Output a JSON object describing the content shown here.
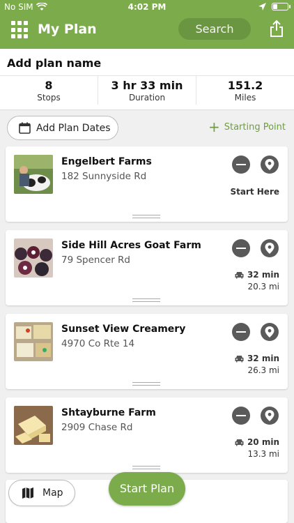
{
  "status_bar": {
    "carrier": "No SIM",
    "time": "4:02 PM"
  },
  "nav": {
    "title": "My Plan",
    "search_label": "Search",
    "menu_icon": "grid-icon",
    "share_icon": "share-icon"
  },
  "summary": {
    "plan_name": "Add plan name",
    "stats": [
      {
        "value": "8",
        "label": "Stops"
      },
      {
        "value": "3 hr 33 min",
        "label": "Duration"
      },
      {
        "value": "151.2",
        "label": "Miles"
      }
    ]
  },
  "actions": {
    "add_dates_label": "Add Plan Dates",
    "starting_point_label": "Starting Point"
  },
  "stops": [
    {
      "name": "Engelbert Farms",
      "address": "182 Sunnyside Rd",
      "start_label": "Start Here"
    },
    {
      "name": "Side Hill Acres Goat Farm",
      "address": "79 Spencer Rd",
      "drive_time": "32 min",
      "distance": "20.3 mi"
    },
    {
      "name": "Sunset View Creamery",
      "address": "4970 Co Rte 14",
      "drive_time": "32 min",
      "distance": "26.3 mi"
    },
    {
      "name": "Shtayburne Farm",
      "address": "2909 Chase Rd",
      "drive_time": "20 min",
      "distance": "13.3 mi"
    }
  ],
  "bottom": {
    "map_label": "Map",
    "start_plan_label": "Start Plan"
  },
  "colors": {
    "brand_green": "#7bab4a",
    "dark_pill": "#6b9641",
    "icon_gray": "#5a5a5a"
  }
}
